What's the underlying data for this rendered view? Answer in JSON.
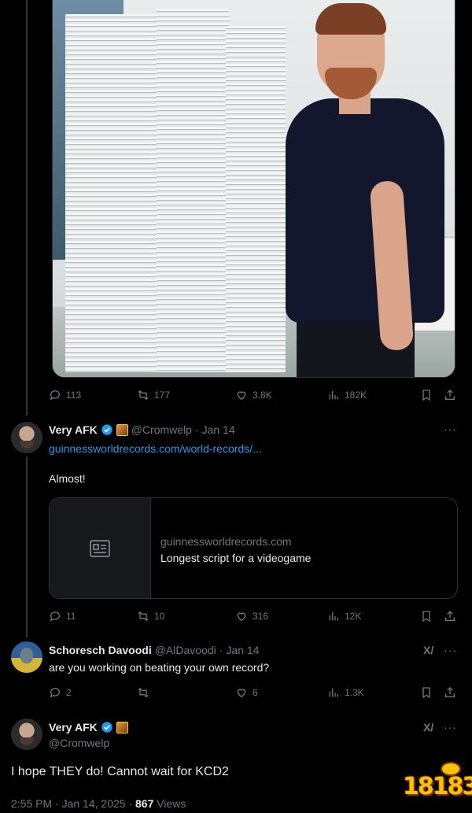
{
  "first_tweet": {
    "stats": {
      "replies": "113",
      "reposts": "177",
      "likes": "3.8K",
      "views": "182K"
    }
  },
  "reply1": {
    "display_name": "Very AFK",
    "handle": "@Cromwelp",
    "separator": "·",
    "date": "Jan 14",
    "link": "guinnessworldrecords.com/world-records/...",
    "text": "Almost!",
    "card": {
      "domain": "guinnessworldrecords.com",
      "title": "Longest script for a videogame"
    },
    "stats": {
      "replies": "11",
      "reposts": "10",
      "likes": "316",
      "views": "12K"
    },
    "more": "···"
  },
  "reply2": {
    "display_name": "Schoresch Davoodi",
    "handle": "@AlDavoodi",
    "separator": "·",
    "date": "Jan 14",
    "text": "are you working on beating your own record?",
    "stats": {
      "replies": "2",
      "reposts": "",
      "likes": "6",
      "views": "1.3K"
    },
    "grok": "X/",
    "more": "···"
  },
  "main_tweet": {
    "display_name": "Very AFK",
    "handle": "@Cromwelp",
    "text": "I hope THEY do! Cannot wait for KCD2",
    "time": "2:55 PM",
    "separator": "·",
    "date": "Jan 14, 2025",
    "views_count": "867",
    "views_label": "Views",
    "grok": "X/",
    "more": "···"
  },
  "watermark": {
    "text": "18183"
  },
  "colors": {
    "accent": "#1d9bf0",
    "muted": "#71767b",
    "text": "#e7e9ea",
    "border": "#2f3336",
    "background": "#000000"
  },
  "icons": [
    "reply-icon",
    "repost-icon",
    "like-icon",
    "views-icon",
    "bookmark-icon",
    "share-icon",
    "verified-icon",
    "game-badge-icon",
    "grok-icon",
    "more-icon",
    "article-icon"
  ]
}
